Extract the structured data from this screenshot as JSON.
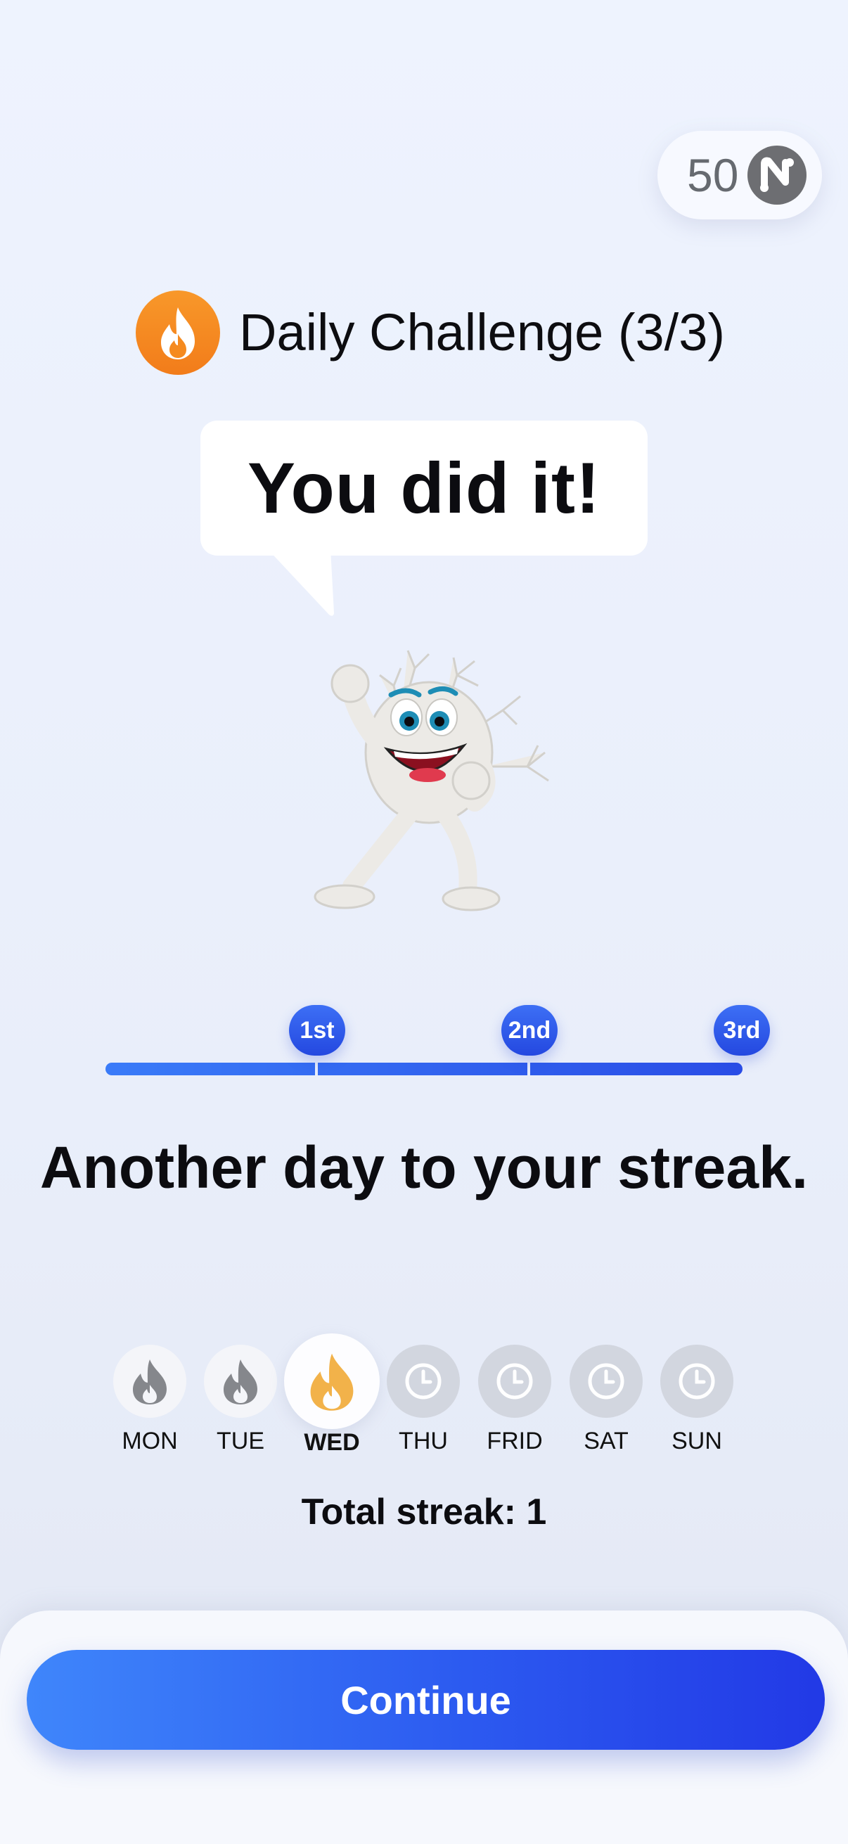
{
  "points": {
    "value": "50",
    "icon": "neuron-coin-icon",
    "badge_color": "#6d6e72"
  },
  "header": {
    "title": "Daily Challenge (3/3)",
    "icon": "flame-icon",
    "icon_color": "#f58a1f"
  },
  "bubble": {
    "text": "You did it!"
  },
  "mascot": {
    "icon": "neuron-mascot-icon"
  },
  "progress": {
    "completed": 3,
    "total": 3,
    "milestones": [
      {
        "label": "1st"
      },
      {
        "label": "2nd"
      },
      {
        "label": "3rd"
      }
    ],
    "accent": "#2a4de6"
  },
  "streak": {
    "heading": "Another day to your streak.",
    "days": [
      {
        "label": "MON",
        "state": "done",
        "icon": "flame-icon"
      },
      {
        "label": "TUE",
        "state": "done",
        "icon": "flame-icon"
      },
      {
        "label": "WED",
        "state": "today",
        "icon": "flame-icon"
      },
      {
        "label": "THU",
        "state": "pending",
        "icon": "clock-icon"
      },
      {
        "label": "FRID",
        "state": "pending",
        "icon": "clock-icon"
      },
      {
        "label": "SAT",
        "state": "pending",
        "icon": "clock-icon"
      },
      {
        "label": "SUN",
        "state": "pending",
        "icon": "clock-icon"
      }
    ],
    "total_label": "Total streak: 1"
  },
  "footer": {
    "continue_label": "Continue"
  }
}
